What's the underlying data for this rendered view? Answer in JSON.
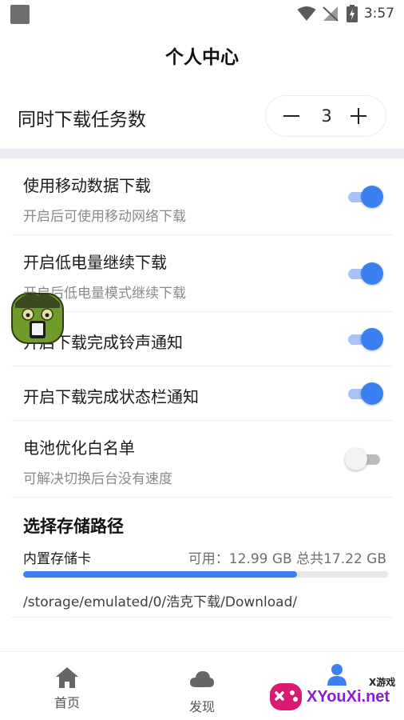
{
  "status_bar": {
    "time": "3:57"
  },
  "header": {
    "title": "个人中心"
  },
  "concurrent_downloads": {
    "label": "同时下载任务数",
    "value": "3"
  },
  "settings": [
    {
      "title": "使用移动数据下载",
      "desc": "开启后可使用移动网络下载",
      "enabled": true
    },
    {
      "title": "开启低电量继续下载",
      "desc": "开启后低电量模式继续下载",
      "enabled": true
    },
    {
      "title": "开启下载完成铃声通知",
      "enabled": true
    },
    {
      "title": "开启下载完成状态栏通知",
      "enabled": true
    },
    {
      "title": "电池优化白名单",
      "desc": "可解决切换后台没有速度",
      "enabled": false
    }
  ],
  "storage": {
    "heading": "选择存储路径",
    "name": "内置存储卡",
    "info": "可用：12.99 GB 总共17.22 GB",
    "used_fraction": 0.75,
    "path": "/storage/emulated/0/浩克下载/Download/"
  },
  "bottom_nav": [
    {
      "label": "首页",
      "icon": "home-icon"
    },
    {
      "label": "发现",
      "icon": "cloud-icon"
    },
    {
      "label": "",
      "icon": "profile-icon"
    }
  ],
  "watermark": {
    "text": "XYouXi.net",
    "small": "X游戏"
  },
  "colors": {
    "accent": "#3b80f0",
    "toggle_track_on": "#a8c3f5",
    "divider": "#e9edf2"
  }
}
